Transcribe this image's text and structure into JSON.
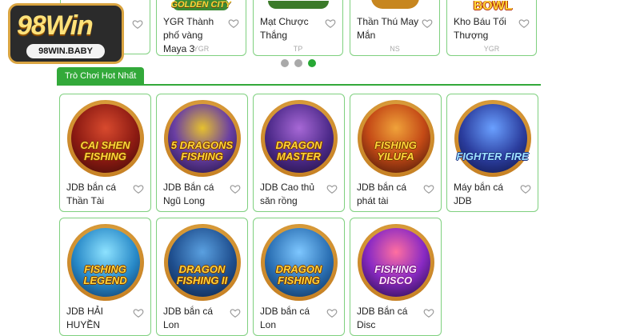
{
  "brand": {
    "logo_text": "98Win",
    "logo_domain": "98WIN.BABY"
  },
  "carousel": {
    "items": [
      {
        "name": "",
        "provider": ""
      },
      {
        "name": "YGR Thành phố vàng Maya 3",
        "provider": "YGR",
        "art": "GOLDEN CITY"
      },
      {
        "name": "Mạt Chược Thắng",
        "provider": "TP",
        "art": ""
      },
      {
        "name": "Thần Thú May Mắn",
        "provider": "NS",
        "art": ""
      },
      {
        "name": "Kho Báu Tối Thượng",
        "provider": "YGR",
        "art": "BOWL"
      }
    ],
    "page_count": 3,
    "active_page": 3
  },
  "section": {
    "title": "Trò Chơi Hot Nhất"
  },
  "games": [
    {
      "name": "JDB bắn cá Thần Tài",
      "art": "CAI SHEN FISHING"
    },
    {
      "name": "JDB Bắn cá Ngũ Long",
      "art": "5 DRAGONS FISHING"
    },
    {
      "name": "JDB Cao thủ săn rồng",
      "art": "DRAGON MASTER"
    },
    {
      "name": "JDB bắn cá phát tài",
      "art": "FISHING YILUFA"
    },
    {
      "name": "Máy bắn cá JDB",
      "art": "FIGHTER FIRE"
    },
    {
      "name": "JDB HẢI HUYỀN",
      "art": "FISHING LEGEND"
    },
    {
      "name": "JDB bắn cá Lon",
      "art": "DRAGON FISHING II"
    },
    {
      "name": "JDB bắn cá Lon",
      "art": "DRAGON FISHING"
    },
    {
      "name": "JDB Bắn cá Disc",
      "art": "FISHING DISCO"
    }
  ],
  "colors": {
    "accent": "#33a93a",
    "card_border": "#7fd07f",
    "dot_inactive": "#a9a9a9"
  }
}
